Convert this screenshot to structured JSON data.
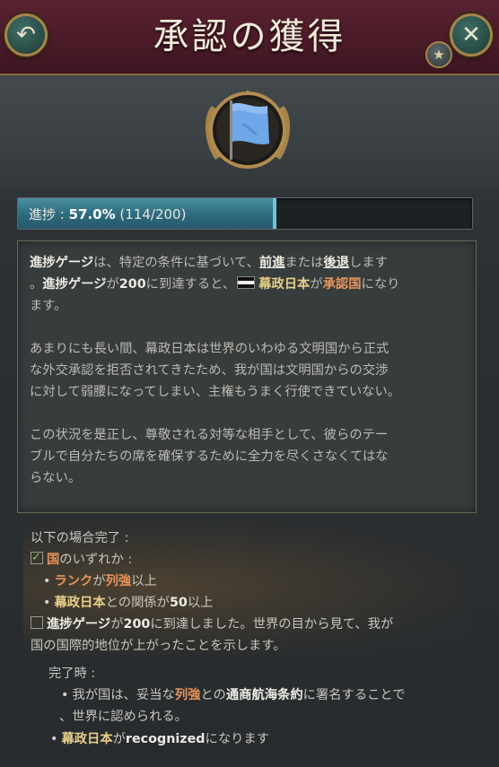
{
  "header": {
    "title": "承認の獲得",
    "back_icon": "↶",
    "close_icon": "✕",
    "star_icon": "★"
  },
  "progress": {
    "label": "進捗 : ",
    "percent_text": "57.0%",
    "count_text": " (114/200)",
    "fraction": 0.57
  },
  "description": {
    "p1_a": "進捗ゲージ",
    "p1_b": "は、特定の条件に基づいて、",
    "p1_c": "前進",
    "p1_d": "または",
    "p1_e": "後退",
    "p1_f": "します",
    "p1_g": "。",
    "p1_h": "進捗ゲージ",
    "p1_i": "が",
    "p1_j": "200",
    "p1_k": "に到達すると、",
    "p1_l": "幕政日本",
    "p1_m": "が",
    "p1_n": "承認国",
    "p1_o": "になり",
    "p1_p": "ます。",
    "p2_l1": "あまりにも長い間、幕政日本は世界のいわゆる文明国から正式",
    "p2_l2": "な外交承認を拒否されてきたため、我が国は文明国からの交渉",
    "p2_l3": "に対して弱腰になってしまい、主権もうまく行使できていない。",
    "p3_l1": "この状況を是正し、尊敬される対等な相手として、彼らのテー",
    "p3_l2": "ブルで自分たちの席を確保するために全力を尽くさなくてはな",
    "p3_l3": "らない。"
  },
  "conditions": {
    "heading": "以下の場合完了 :",
    "c1_a": "国",
    "c1_b": "のいずれか :",
    "c2_a": "ランク",
    "c2_b": "が",
    "c2_c": "列強",
    "c2_d": "以上",
    "c3_a": "幕政日本",
    "c3_b": "との関係が",
    "c3_c": "50",
    "c3_d": "以上",
    "c4_a": "進捗ゲージ",
    "c4_b": "が",
    "c4_c": "200",
    "c4_d": "に到達しました。世界の目から見て、我が",
    "c4_e": "国の国際的地位が上がったことを示します。"
  },
  "on_complete": {
    "heading": "完了時 :",
    "e1_a": "我が国は、妥当な",
    "e1_b": "列強",
    "e1_c": "との",
    "e1_d": "通商航海条約",
    "e1_e": "に署名することで",
    "e1_f": "、世界に認められる。",
    "e2_a": "幕政日本",
    "e2_b": "が",
    "e2_c": "recognized",
    "e2_d": "になります"
  }
}
